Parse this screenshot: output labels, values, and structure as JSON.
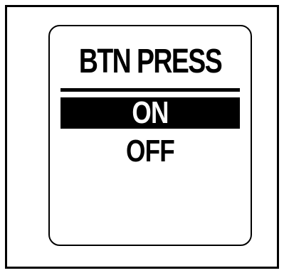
{
  "screen": {
    "title": "BTN PRESS",
    "options": [
      {
        "label": "ON",
        "selected": true
      },
      {
        "label": "OFF",
        "selected": false
      }
    ]
  },
  "colors": {
    "foreground": "#000000",
    "background": "#ffffff"
  }
}
